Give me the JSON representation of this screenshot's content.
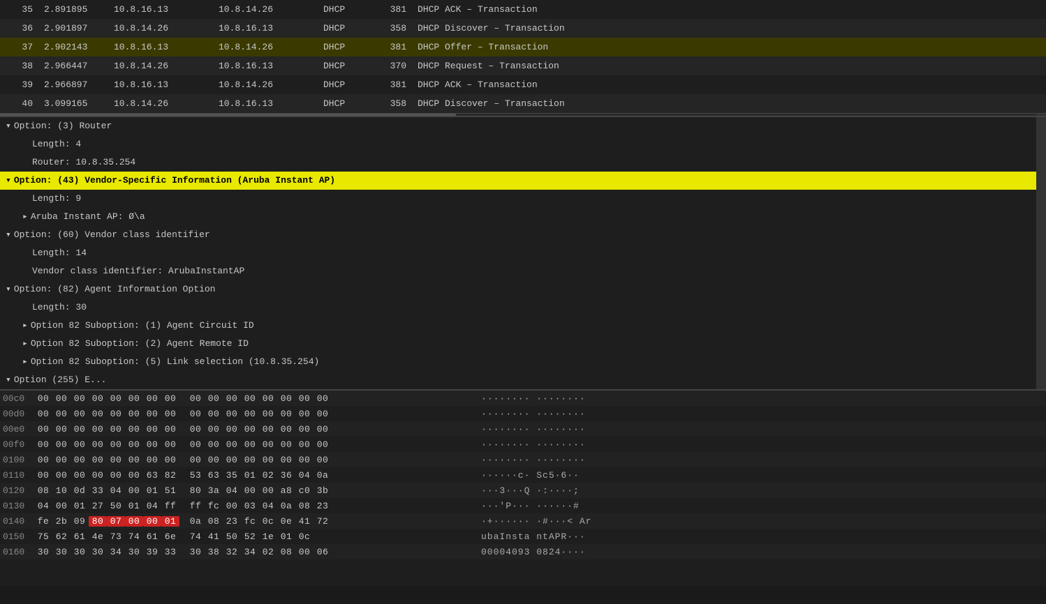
{
  "packets": [
    {
      "no": "35",
      "time": "2.891895",
      "src": "10.8.16.13",
      "dst": "10.8.14.26",
      "proto": "DHCP",
      "len": "381",
      "info": "DHCP ACK    – Transaction",
      "selected": false
    },
    {
      "no": "36",
      "time": "2.901897",
      "src": "10.8.14.26",
      "dst": "10.8.16.13",
      "proto": "DHCP",
      "len": "358",
      "info": "DHCP Discover – Transaction",
      "selected": false
    },
    {
      "no": "37",
      "time": "2.902143",
      "src": "10.8.16.13",
      "dst": "10.8.14.26",
      "proto": "DHCP",
      "len": "381",
      "info": "DHCP Offer    – Transaction",
      "selected": true
    },
    {
      "no": "38",
      "time": "2.966447",
      "src": "10.8.14.26",
      "dst": "10.8.16.13",
      "proto": "DHCP",
      "len": "370",
      "info": "DHCP Request  – Transaction",
      "selected": false
    },
    {
      "no": "39",
      "time": "2.966897",
      "src": "10.8.16.13",
      "dst": "10.8.14.26",
      "proto": "DHCP",
      "len": "381",
      "info": "DHCP ACK    – Transaction",
      "selected": false
    },
    {
      "no": "40",
      "time": "3.099165",
      "src": "10.8.14.26",
      "dst": "10.8.16.13",
      "proto": "DHCP",
      "len": "358",
      "info": "DHCP Discover – Transaction",
      "selected": false
    }
  ],
  "detail_items": [
    {
      "level": 1,
      "expand": "v",
      "text": "Option: (3) Router",
      "highlighted": false
    },
    {
      "level": 2,
      "expand": "",
      "text": "Length: 4",
      "highlighted": false
    },
    {
      "level": 2,
      "expand": "",
      "text": "Router: 10.8.35.254",
      "highlighted": false
    },
    {
      "level": 1,
      "expand": "v",
      "text": "Option: (43) Vendor-Specific Information (Aruba Instant AP)",
      "highlighted": true
    },
    {
      "level": 2,
      "expand": "",
      "text": "Length: 9",
      "highlighted": false
    },
    {
      "level": 2,
      "expand": ">",
      "text": "Aruba Instant AP: Ø\\a",
      "highlighted": false
    },
    {
      "level": 1,
      "expand": "v",
      "text": "Option: (60) Vendor class identifier",
      "highlighted": false
    },
    {
      "level": 2,
      "expand": "",
      "text": "Length: 14",
      "highlighted": false
    },
    {
      "level": 2,
      "expand": "",
      "text": "Vendor class identifier: ArubaInstantAP",
      "highlighted": false
    },
    {
      "level": 1,
      "expand": "v",
      "text": "Option: (82) Agent Information Option",
      "highlighted": false
    },
    {
      "level": 2,
      "expand": "",
      "text": "Length: 30",
      "highlighted": false
    },
    {
      "level": 2,
      "expand": ">",
      "text": "Option 82 Suboption: (1) Agent Circuit ID",
      "highlighted": false
    },
    {
      "level": 2,
      "expand": ">",
      "text": "Option 82 Suboption: (2) Agent Remote ID",
      "highlighted": false
    },
    {
      "level": 2,
      "expand": ">",
      "text": "Option 82 Suboption: (5) Link selection (10.8.35.254)",
      "highlighted": false
    },
    {
      "level": 1,
      "expand": "v",
      "text": "Option (255) E...",
      "highlighted": false
    }
  ],
  "hex_rows": [
    {
      "offset": "00c0",
      "bytes": [
        "00",
        "00",
        "00",
        "00",
        "00",
        "00",
        "00",
        "00",
        "00",
        "00",
        "00",
        "00",
        "00",
        "00",
        "00",
        "00"
      ],
      "ascii": "········ ········",
      "highlight_start": -1,
      "highlight_end": -1
    },
    {
      "offset": "00d0",
      "bytes": [
        "00",
        "00",
        "00",
        "00",
        "00",
        "00",
        "00",
        "00",
        "00",
        "00",
        "00",
        "00",
        "00",
        "00",
        "00",
        "00"
      ],
      "ascii": "········ ········",
      "highlight_start": -1,
      "highlight_end": -1
    },
    {
      "offset": "00e0",
      "bytes": [
        "00",
        "00",
        "00",
        "00",
        "00",
        "00",
        "00",
        "00",
        "00",
        "00",
        "00",
        "00",
        "00",
        "00",
        "00",
        "00"
      ],
      "ascii": "········ ········",
      "highlight_start": -1,
      "highlight_end": -1
    },
    {
      "offset": "00f0",
      "bytes": [
        "00",
        "00",
        "00",
        "00",
        "00",
        "00",
        "00",
        "00",
        "00",
        "00",
        "00",
        "00",
        "00",
        "00",
        "00",
        "00"
      ],
      "ascii": "········ ········",
      "highlight_start": -1,
      "highlight_end": -1
    },
    {
      "offset": "0100",
      "bytes": [
        "00",
        "00",
        "00",
        "00",
        "00",
        "00",
        "00",
        "00",
        "00",
        "00",
        "00",
        "00",
        "00",
        "00",
        "00",
        "00"
      ],
      "ascii": "········ ········",
      "highlight_start": -1,
      "highlight_end": -1
    },
    {
      "offset": "0110",
      "bytes": [
        "00",
        "00",
        "00",
        "00",
        "00",
        "00",
        "63",
        "82",
        "53",
        "63",
        "35",
        "01",
        "02",
        "36",
        "04",
        "0a"
      ],
      "ascii": "······c· Sc5·6··",
      "highlight_start": -1,
      "highlight_end": -1
    },
    {
      "offset": "0120",
      "bytes": [
        "08",
        "10",
        "0d",
        "33",
        "04",
        "00",
        "01",
        "51",
        "80",
        "3a",
        "04",
        "00",
        "00",
        "a8",
        "c0",
        "3b"
      ],
      "ascii": "···3···Q ·:····;",
      "highlight_start": -1,
      "highlight_end": -1
    },
    {
      "offset": "0130",
      "bytes": [
        "04",
        "00",
        "01",
        "27",
        "50",
        "01",
        "04",
        "ff",
        "ff",
        "fc",
        "00",
        "03",
        "04",
        "0a",
        "08",
        "23"
      ],
      "ascii": "···'P··· ······#",
      "highlight_start": -1,
      "highlight_end": -1
    },
    {
      "offset": "0140",
      "bytes": [
        "fe",
        "2b",
        "09",
        "80",
        "07",
        "00",
        "00",
        "01",
        "0a",
        "08",
        "23",
        "fc",
        "0c",
        "0e",
        "41",
        "72"
      ],
      "ascii": "·+······ ·#···< Ar",
      "highlight_start": 3,
      "highlight_end": 7
    },
    {
      "offset": "0150",
      "bytes": [
        "75",
        "62",
        "61",
        "4e",
        "73",
        "74",
        "61",
        "6e",
        "74",
        "41",
        "50",
        "52",
        "1e",
        "01",
        "0c"
      ],
      "ascii": "ubaInsta ntAPR···",
      "highlight_start": -1,
      "highlight_end": -1
    },
    {
      "offset": "0160",
      "bytes": [
        "30",
        "30",
        "30",
        "30",
        "34",
        "30",
        "39",
        "33",
        "30",
        "38",
        "32",
        "34",
        "02",
        "08",
        "00",
        "06"
      ],
      "ascii": "00004093 0824····",
      "highlight_start": -1,
      "highlight_end": -1
    }
  ]
}
